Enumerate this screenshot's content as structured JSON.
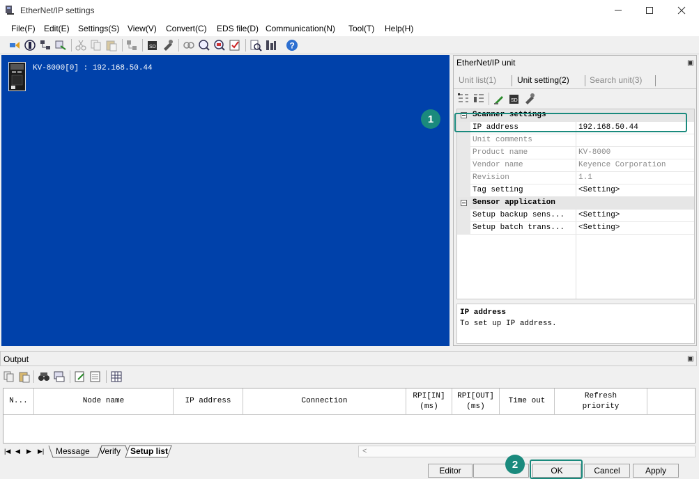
{
  "window": {
    "title": "EtherNet/IP settings",
    "controls": [
      "minimize-icon",
      "maximize-icon",
      "close-icon"
    ]
  },
  "menu": [
    "File(F)",
    "Edit(E)",
    "Settings(S)",
    "View(V)",
    "Convert(C)",
    "EDS file(D)",
    "Communication(N)",
    "Tool(T)",
    "Help(H)"
  ],
  "canvas": {
    "background": "#0041aa",
    "device_label": "KV-8000[0] : 192.168.50.44"
  },
  "unit_panel": {
    "title": "EtherNet/IP unit",
    "tabs": [
      {
        "label": "Unit list(1)",
        "active": false
      },
      {
        "label": "Unit setting(2)",
        "active": true
      },
      {
        "label": "Search unit(3)",
        "active": false
      }
    ],
    "categories": {
      "scanner": "Scanner settings",
      "sensor": "Sensor application"
    },
    "properties": [
      {
        "key": "IP address",
        "value": "192.168.50.44"
      },
      {
        "key": "Unit comments",
        "value": ""
      },
      {
        "key": "Product name",
        "value": "KV-8000"
      },
      {
        "key": "Vendor name",
        "value": "Keyence Corporation"
      },
      {
        "key": "Revision",
        "value": "1.1"
      },
      {
        "key": "Tag setting",
        "value": "<Setting>"
      },
      {
        "key": "Setup backup sens...",
        "value": "<Setting>"
      },
      {
        "key": "Setup batch trans...",
        "value": "<Setting>"
      }
    ],
    "description": {
      "title": "IP address",
      "text": "To set up IP address."
    }
  },
  "callouts": [
    "1",
    "2"
  ],
  "accent": "#1a8a7d",
  "output": {
    "title": "Output",
    "columns": [
      "N...",
      "Node name",
      "IP address",
      "Connection",
      "RPI[IN]\n(ms)",
      "RPI[OUT]\n(ms)",
      "Time out",
      "Refresh\npriority"
    ]
  },
  "bottom_tabs": [
    {
      "label": "Message",
      "active": false
    },
    {
      "label": "Verify",
      "active": false
    },
    {
      "label": "Setup list",
      "active": true
    }
  ],
  "status": {
    "mode": "Editor",
    "ok": "OK",
    "cancel": "Cancel",
    "apply": "Apply"
  }
}
